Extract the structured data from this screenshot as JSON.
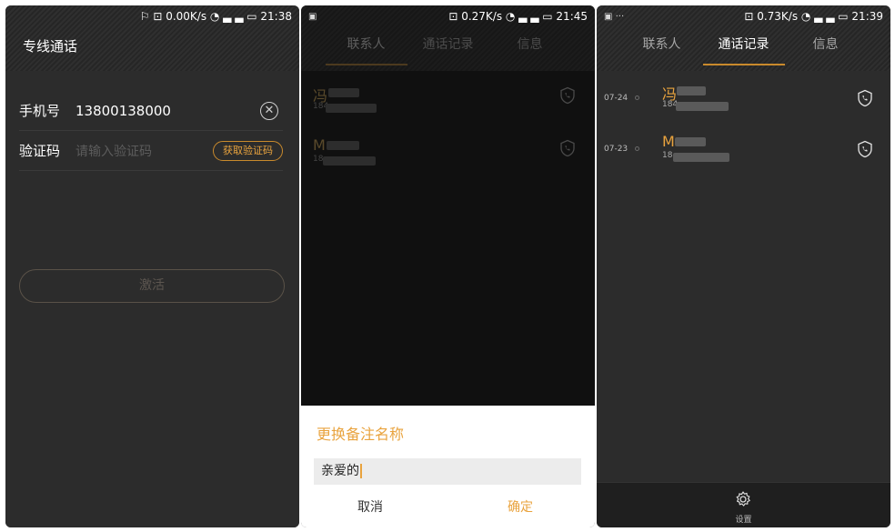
{
  "screen1": {
    "status": {
      "left": "",
      "right": "⚐ ⊡ 0.00K/s ◔ ▃ ▃ ▭ 21:38"
    },
    "title": "专线通话",
    "phone_label": "手机号",
    "phone_value": "13800138000",
    "code_label": "验证码",
    "code_placeholder": "请输入验证码",
    "get_code_button": "获取验证码",
    "activate_button": "激活",
    "clear_icon": "close-circle-icon"
  },
  "screen2": {
    "status": {
      "left": "▣",
      "right": "⊡ 0.27K/s ◔ ▃ ▃ ▭ 21:45"
    },
    "tabs": [
      "联系人",
      "通话记录",
      "信息"
    ],
    "active_tab": 0,
    "contacts": [
      {
        "name": "冯",
        "number": "184"
      },
      {
        "name": "M",
        "number": "18"
      }
    ],
    "dialog": {
      "title": "更换备注名称",
      "input_value": "亲爱的",
      "cancel": "取消",
      "confirm": "确定"
    }
  },
  "screen3": {
    "status": {
      "left": "▣ ···",
      "right": "⊡ 0.73K/s ◔ ▃ ▃ ▭ 21:39"
    },
    "tabs": [
      "联系人",
      "通话记录",
      "信息"
    ],
    "active_tab": 1,
    "calls": [
      {
        "date": "07-24",
        "name": "冯",
        "number": "184"
      },
      {
        "date": "07-23",
        "name": "M",
        "number": "18"
      }
    ],
    "settings_label": "设置"
  },
  "colors": {
    "accent": "#e9a33e",
    "background": "#2c2c2c"
  }
}
